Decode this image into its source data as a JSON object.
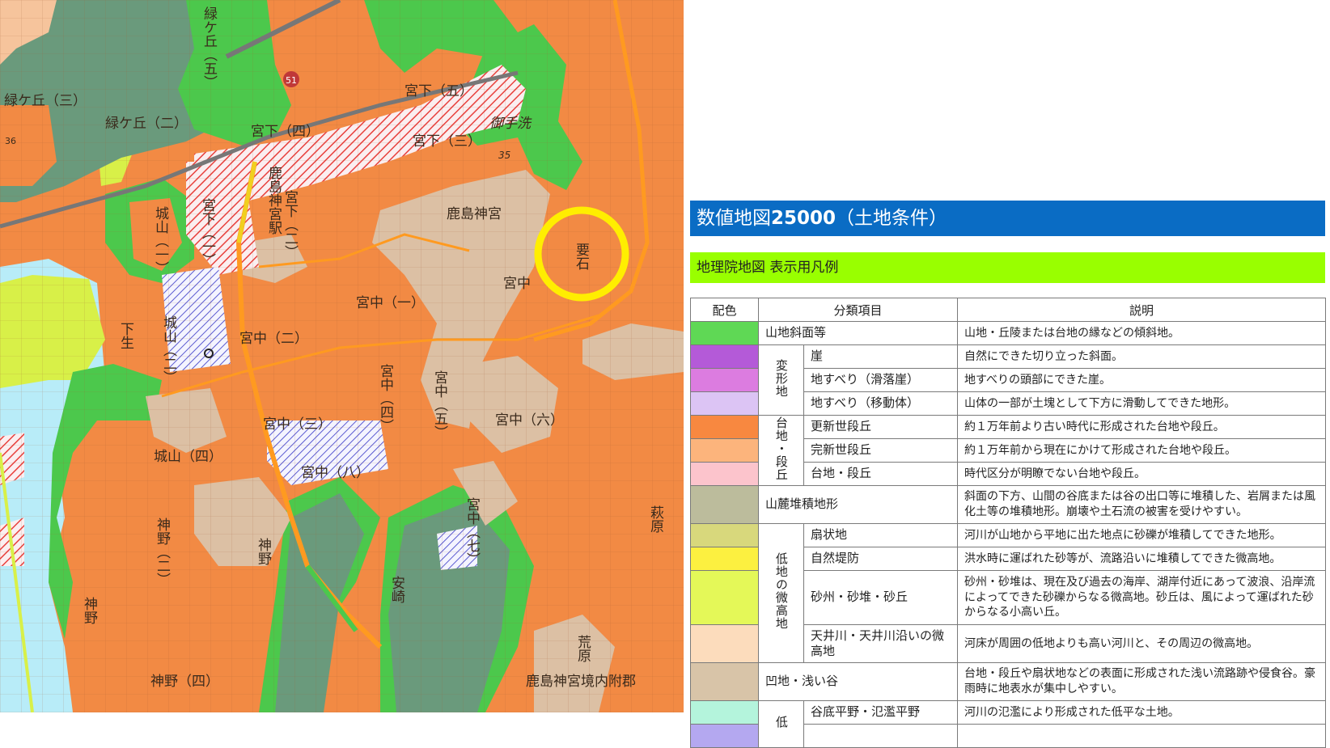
{
  "map": {
    "labels": {
      "midorigaoka_3": "緑ケ丘（三）",
      "midorigaoka_2": "緑ケ丘（二）",
      "midorigaoka_5": "緑ケ丘（五）",
      "miyashita_5": "宮下（五）",
      "miyashita_4": "宮下（四）",
      "miyashita_3": "宮下（三）",
      "miyashita_2": "宮下（二）",
      "miyashita_1": "宮下（一）",
      "mitarashi": "御手洗",
      "kashima_jingu_eki": "鹿島神宮駅",
      "kashima_jingu": "鹿島神宮",
      "kaname_ishi": "要石",
      "miyanaka": "宮中",
      "miyanaka_1": "宮中（一）",
      "miyanaka_2": "宮中（二）",
      "miyanaka_3": "宮中（三）",
      "miyanaka_4": "宮中（四）",
      "miyanaka_5": "宮中（五）",
      "miyanaka_6": "宮中（六）",
      "miyanaka_7": "宮中（七）",
      "miyanaka_8": "宮中（八）",
      "jouyama_1": "城山（一）",
      "jouyama_2": "城山（二）",
      "jouyama_4": "城山（四）",
      "shimoiku": "下生",
      "jinno": "神野",
      "jinno_2": "神野（二）",
      "jinno_4": "神野（四）",
      "yasuzaki": "安崎",
      "arahara": "荒原",
      "hagiwara": "萩原",
      "keidai": "鹿島神宮境内附郡",
      "route_51": "51",
      "elev_35": "35",
      "elev_36": "36"
    }
  },
  "legend": {
    "title_prefix": "数値地図",
    "title_bold": "25000",
    "title_suffix": "（土地条件）",
    "subtitle": "地理院地図 表示用凡例",
    "headers": {
      "color": "配色",
      "category": "分類項目",
      "description": "説明"
    },
    "rows": [
      {
        "group": "",
        "color": "#5fd855",
        "item": "山地斜面等",
        "description": "山地・丘陵または台地の縁などの傾斜地。"
      },
      {
        "group": "変形地",
        "color": "#b45ad8",
        "item": "崖",
        "description": "自然にできた切り立った斜面。"
      },
      {
        "group": "変形地",
        "color": "#dc7ce0",
        "item": "地すべり（滑落崖）",
        "description": "地すべりの頭部にできた崖。"
      },
      {
        "group": "変形地",
        "color": "#dcc4f4",
        "item": "地すべり（移動体）",
        "description": "山体の一部が土塊として下方に滑動してできた地形。"
      },
      {
        "group": "台地・段丘",
        "color": "#f88840",
        "item": "更新世段丘",
        "description": "約１万年前より古い時代に形成された台地や段丘。"
      },
      {
        "group": "台地・段丘",
        "color": "#fcb47c",
        "item": "完新世段丘",
        "description": "約１万年前から現在にかけて形成された台地や段丘。"
      },
      {
        "group": "台地・段丘",
        "color": "#fcc4cc",
        "item": "台地・段丘",
        "description": "時代区分が明瞭でない台地や段丘。"
      },
      {
        "group": "",
        "color": "#bcbc9c",
        "item": "山麓堆積地形",
        "description": "斜面の下方、山間の谷底または谷の出口等に堆積した、岩屑または風化土等の堆積地形。崩壊や土石流の被害を受けやすい。"
      },
      {
        "group": "低地の微高地",
        "color": "#d8d87c",
        "item": "扇状地",
        "description": "河川が山地から平地に出た地点に砂礫が堆積してできた地形。"
      },
      {
        "group": "低地の微高地",
        "color": "#fcf040",
        "item": "自然堤防",
        "description": "洪水時に運ばれた砂等が、流路沿いに堆積してできた微高地。"
      },
      {
        "group": "低地の微高地",
        "color": "#e4f858",
        "item": "砂州・砂堆・砂丘",
        "description": "砂州・砂堆は、現在及び過去の海岸、湖岸付近にあって波浪、沿岸流によってできた砂礫からなる微高地。砂丘は、風によって運ばれた砂からなる小高い丘。"
      },
      {
        "group": "低地の微高地",
        "color": "#fcdcbc",
        "item": "天井川・天井川沿いの微高地",
        "description": "河床が周囲の低地よりも高い河川と、その周辺の微高地。"
      },
      {
        "group": "",
        "color": "#d8c4a8",
        "item": "凹地・浅い谷",
        "description": "台地・段丘や扇状地などの表面に形成された浅い流路跡や侵食谷。豪雨時に地表水が集中しやすい。"
      },
      {
        "group": "低",
        "color": "#b4f4dc",
        "item": "谷底平野・氾濫平野",
        "description": "河川の氾濫により形成された低平な土地。"
      },
      {
        "group": "低",
        "color": "#b4a8f0",
        "item": "",
        "description": ""
      }
    ]
  },
  "colors": {
    "terrace_orange": "#f28a44",
    "slope_green": "#4cc84c",
    "forest_dark_green": "#6a9a7c",
    "valley_tan": "#dcc0a4",
    "lowland_cyan": "#b8ecf8",
    "sand_yellow_green": "#d8f048",
    "highlight_circle": "#ffee00",
    "header_blue": "#0a6cc4",
    "subheader_green": "#99ff00"
  }
}
